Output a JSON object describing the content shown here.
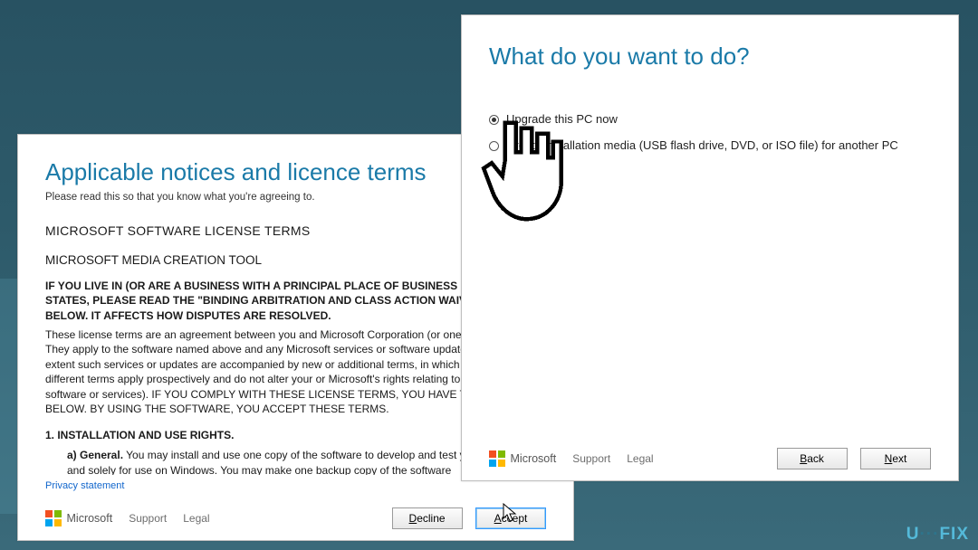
{
  "dialog1": {
    "title": "Applicable notices and licence terms",
    "subtitle": "Please read this so that you know what you're agreeing to.",
    "license": {
      "h1": "MICROSOFT SOFTWARE LICENSE TERMS",
      "h2": "MICROSOFT MEDIA CREATION TOOL",
      "arb1": "IF YOU LIVE IN (OR ARE A BUSINESS WITH A PRINCIPAL PLACE OF BUSINESS IN) THE UNITED STATES, PLEASE READ THE \"BINDING ARBITRATION AND CLASS ACTION WAIVER\" SECTION BELOW. IT AFFECTS HOW DISPUTES ARE RESOLVED.",
      "body": "These license terms are an agreement between you and Microsoft Corporation (or one of its affiliates). They apply to the software named above and any Microsoft services or software updates (except to the extent such services or updates are accompanied by new or additional terms, in which case those different terms apply prospectively and do not alter your or Microsoft's rights relating to pre-updated software or services). IF YOU COMPLY WITH THESE LICENSE TERMS, YOU HAVE THE RIGHTS BELOW. BY USING THE SOFTWARE, YOU ACCEPT THESE TERMS.",
      "sec1": "1.   INSTALLATION AND USE RIGHTS.",
      "sec1a_label": "a)   General.",
      "sec1a_body": " You may install and use one copy of the software to develop and test your applications, and solely for use on Windows. You may make one backup copy of the software"
    },
    "privacy": "Privacy statement",
    "footer": {
      "brand": "Microsoft",
      "support": "Support",
      "legal": "Legal",
      "decline": "Decline",
      "accept": "Accept"
    }
  },
  "dialog2": {
    "title": "What do you want to do?",
    "options": {
      "upgrade": "Upgrade this PC now",
      "create": "Create installation media (USB flash drive, DVD, or ISO file) for another PC"
    },
    "footer": {
      "brand": "Microsoft",
      "support": "Support",
      "legal": "Legal",
      "back": "Back",
      "next": "Next"
    }
  },
  "watermark": "U···FIX"
}
